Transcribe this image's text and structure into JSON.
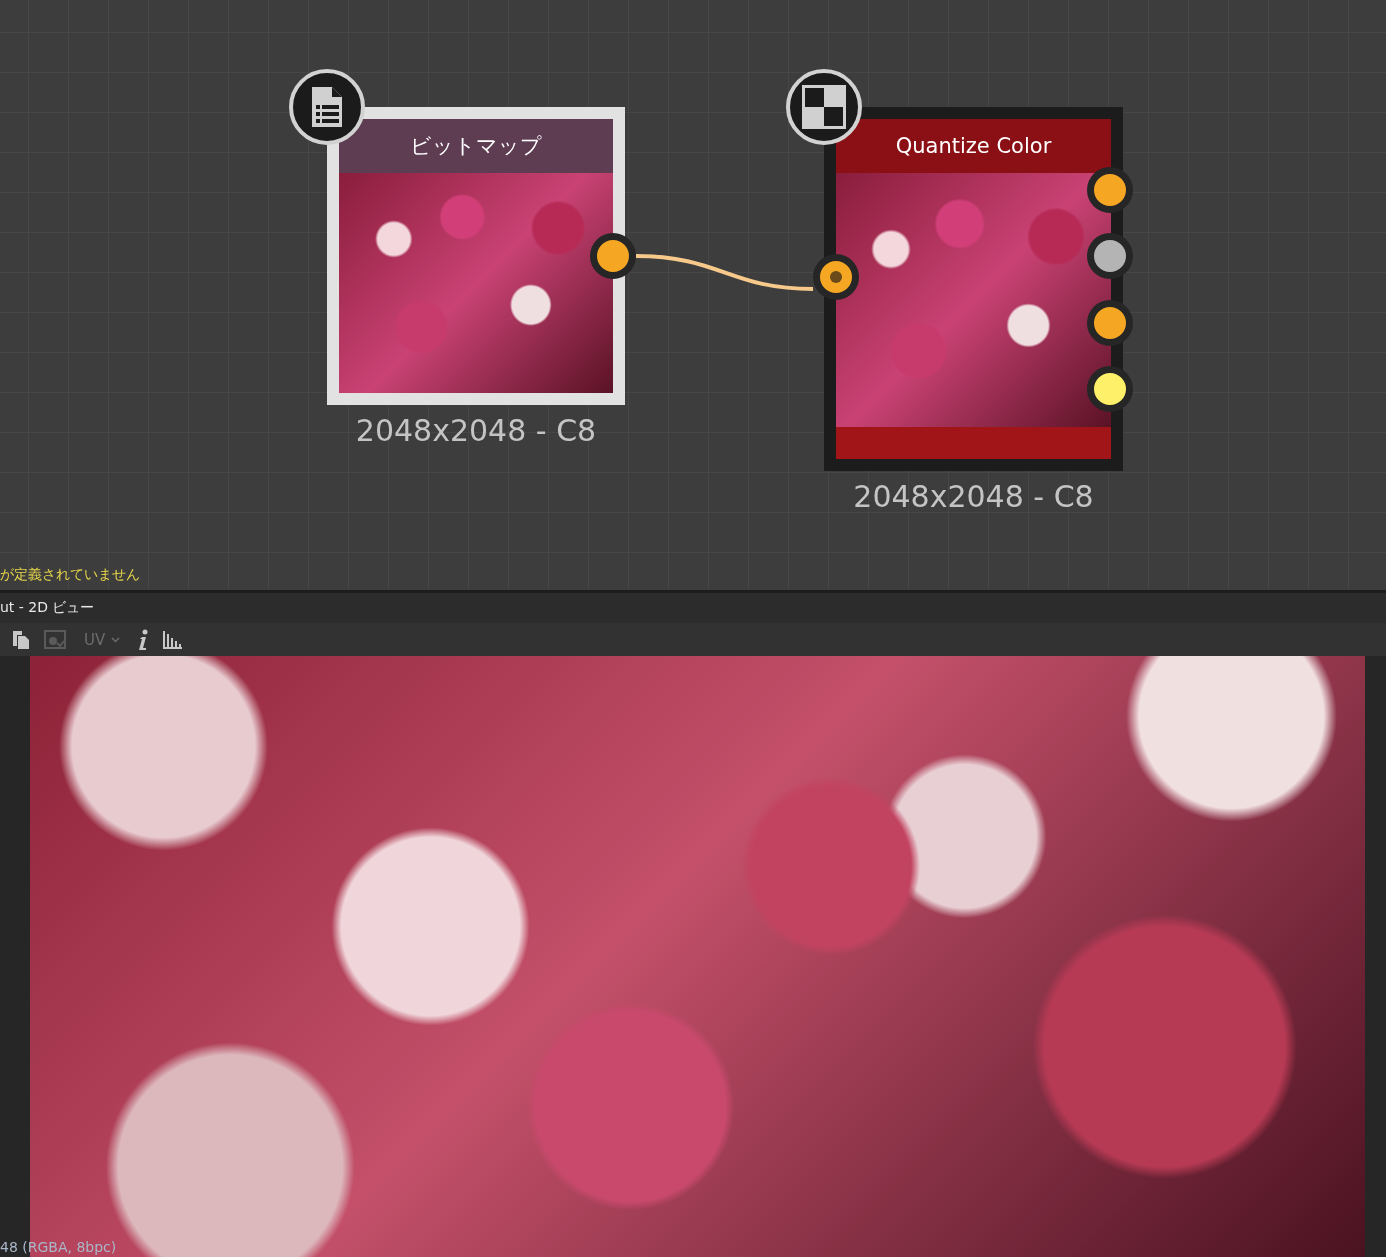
{
  "graph": {
    "nodes": [
      {
        "kind": "bitmap",
        "title": "ビットマップ",
        "selected": true,
        "caption": "2048x2048 - C8",
        "outputs": [
          {
            "color": "#f5a623"
          }
        ]
      },
      {
        "kind": "filter",
        "title": "Quantize Color",
        "selected": false,
        "caption": "2048x2048 - C8",
        "inputs": [
          {
            "color": "#f5a623"
          }
        ],
        "outputs": [
          {
            "color": "#f5a623"
          },
          {
            "color": "#b4b4b4"
          },
          {
            "color": "#f5a623"
          },
          {
            "color": "#fff06a"
          }
        ]
      }
    ],
    "warning": "が定義されていません"
  },
  "viewer": {
    "title": "ut - 2D ビュー",
    "uv_label": "UV",
    "status": "48 (RGBA, 8bpc)"
  }
}
